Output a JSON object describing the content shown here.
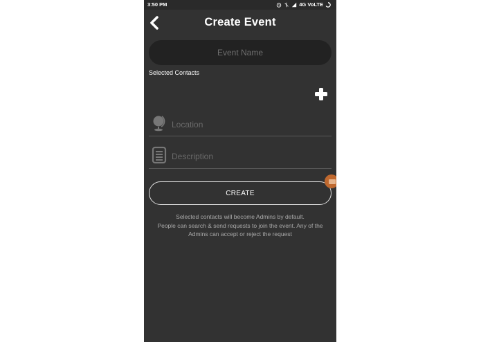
{
  "status_bar": {
    "time": "3:50 PM",
    "network": "4G VoLTE",
    "icons": [
      "alarm-icon",
      "vibrate-icon",
      "signal-icon",
      "battery-icon"
    ]
  },
  "header": {
    "title": "Create Event",
    "back_icon": "chevron-left-icon"
  },
  "form": {
    "event_name_placeholder": "Event Name",
    "selected_contacts_label": "Selected Contacts",
    "add_icon": "plus-icon",
    "location_placeholder": "Location",
    "location_icon": "globe-icon",
    "description_placeholder": "Description",
    "description_icon": "document-icon",
    "create_label": "CREATE"
  },
  "info": {
    "line1": "Selected contacts will become Admins by default.",
    "line2": "People can search & send requests to join the event. Any of the",
    "line3": "Admins can accept or reject the request"
  },
  "colors": {
    "background": "#323232",
    "input_background": "#222222",
    "accent_fab": "#c0692f",
    "text": "#ffffff",
    "muted_text": "#aaaaaa"
  }
}
